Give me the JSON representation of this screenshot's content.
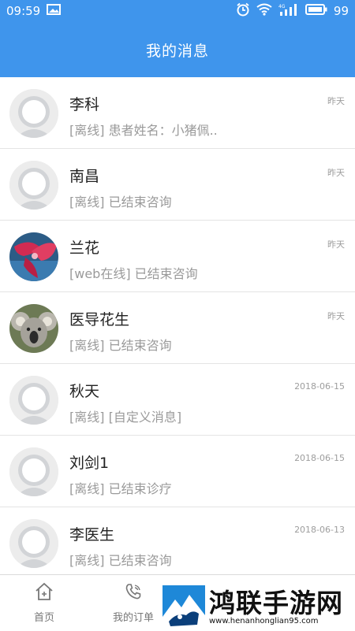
{
  "status_bar": {
    "time": "09:59",
    "battery": "99"
  },
  "header": {
    "title": "我的消息"
  },
  "messages": [
    {
      "name": "李科",
      "preview": "[离线]  患者姓名：小猪佩..",
      "time": "昨天",
      "avatar": "default"
    },
    {
      "name": "南昌",
      "preview": "[离线]  已结束咨询",
      "time": "昨天",
      "avatar": "default"
    },
    {
      "name": "兰花",
      "preview": "[web在线]  已结束咨询",
      "time": "昨天",
      "avatar": "flower"
    },
    {
      "name": "医导花生",
      "preview": "[离线]  已结束咨询",
      "time": "昨天",
      "avatar": "koala"
    },
    {
      "name": "秋天",
      "preview": "[离线]  [自定义消息]",
      "time": "2018-06-15",
      "avatar": "default"
    },
    {
      "name": "刘剑1",
      "preview": "[离线]  已结束诊疗",
      "time": "2018-06-15",
      "avatar": "default"
    },
    {
      "name": "李医生",
      "preview": "[离线]  已结束咨询",
      "time": "2018-06-13",
      "avatar": "default"
    }
  ],
  "tabs": [
    {
      "label": "首页",
      "icon": "home-icon"
    },
    {
      "label": "我的订单",
      "icon": "phone-icon"
    }
  ],
  "watermark": {
    "title": "鸿联手游网",
    "url": "www.henanhonglian95.com"
  },
  "colors": {
    "primary": "#3f95ec"
  }
}
